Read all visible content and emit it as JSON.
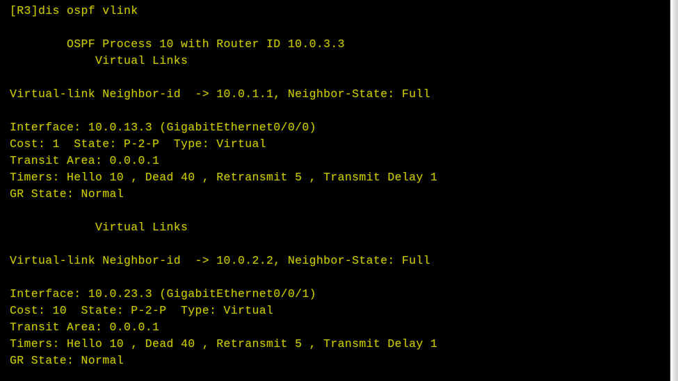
{
  "terminal": {
    "background_color": "#000000",
    "text_color": "#c9c900",
    "prompt_line": "[R3]dis ospf vlink",
    "device_name": "R3",
    "command": "dis ospf vlink",
    "ospf_process_header": "        OSPF Process 10 with Router ID 10.0.3.3",
    "process_id": "10",
    "router_id": "10.0.3.3",
    "lines": [
      "[R3]dis ospf vlink",
      "",
      "        OSPF Process 10 with Router ID 10.0.3.3",
      "            Virtual Links",
      "",
      "Virtual-link Neighbor-id  -> 10.0.1.1, Neighbor-State: Full",
      "",
      "Interface: 10.0.13.3 (GigabitEthernet0/0/0)",
      "Cost: 1  State: P-2-P  Type: Virtual",
      "Transit Area: 0.0.0.1",
      "Timers: Hello 10 , Dead 40 , Retransmit 5 , Transmit Delay 1",
      "GR State: Normal",
      "",
      "            Virtual Links",
      "",
      "Virtual-link Neighbor-id  -> 10.0.2.2, Neighbor-State: Full",
      "",
      "Interface: 10.0.23.3 (GigabitEthernet0/0/1)",
      "Cost: 10  State: P-2-P  Type: Virtual",
      "Transit Area: 0.0.0.1",
      "Timers: Hello 10 , Dead 40 , Retransmit 5 , Transmit Delay 1",
      "GR State: Normal"
    ],
    "virtual_links": [
      {
        "section_title": "Virtual Links",
        "neighbor_line": "Virtual-link Neighbor-id  -> 10.0.1.1, Neighbor-State: Full",
        "neighbor_id": "10.0.1.1",
        "neighbor_state": "Full",
        "interface_line": "Interface: 10.0.13.3 (GigabitEthernet0/0/0)",
        "interface_ip": "10.0.13.3",
        "interface_name": "GigabitEthernet0/0/0",
        "cost_line": "Cost: 1  State: P-2-P  Type: Virtual",
        "cost": "1",
        "state": "P-2-P",
        "type": "Virtual",
        "transit_area_line": "Transit Area: 0.0.0.1",
        "transit_area": "0.0.0.1",
        "timers_line": "Timers: Hello 10 , Dead 40 , Retransmit 5 , Transmit Delay 1",
        "hello": "10",
        "dead": "40",
        "retransmit": "5",
        "transmit_delay": "1",
        "gr_state_line": "GR State: Normal",
        "gr_state": "Normal"
      },
      {
        "section_title": "Virtual Links",
        "neighbor_line": "Virtual-link Neighbor-id  -> 10.0.2.2, Neighbor-State: Full",
        "neighbor_id": "10.0.2.2",
        "neighbor_state": "Full",
        "interface_line": "Interface: 10.0.23.3 (GigabitEthernet0/0/1)",
        "interface_ip": "10.0.23.3",
        "interface_name": "GigabitEthernet0/0/1",
        "cost_line": "Cost: 10  State: P-2-P  Type: Virtual",
        "cost": "10",
        "state": "P-2-P",
        "type": "Virtual",
        "transit_area_line": "Transit Area: 0.0.0.1",
        "transit_area": "0.0.0.1",
        "timers_line": "Timers: Hello 10 , Dead 40 , Retransmit 5 , Transmit Delay 1",
        "hello": "10",
        "dead": "40",
        "retransmit": "5",
        "transmit_delay": "1",
        "gr_state_line": "GR State: Normal",
        "gr_state": "Normal"
      }
    ]
  }
}
